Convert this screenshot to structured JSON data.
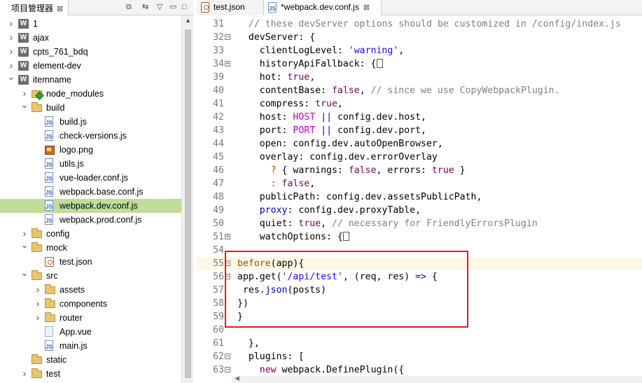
{
  "left_panel": {
    "tab_label": "项目管理器",
    "tab_close": "⊠",
    "toolbar": [
      "⧉",
      "⇆",
      "▽",
      "▭",
      "□"
    ],
    "tree": [
      {
        "label": "1",
        "icon": "project-icon",
        "depth": 0,
        "expanded": false
      },
      {
        "label": "ajax",
        "icon": "project-icon",
        "depth": 0,
        "expanded": false
      },
      {
        "label": "cpts_761_bdq",
        "icon": "project-icon",
        "depth": 0,
        "expanded": false
      },
      {
        "label": "element-dev",
        "icon": "project-icon",
        "depth": 0,
        "expanded": false
      },
      {
        "label": "itemname",
        "icon": "project-icon",
        "depth": 0,
        "expanded": true
      },
      {
        "label": "node_modules",
        "icon": "node-modules-folder-icon",
        "depth": 1,
        "expanded": false
      },
      {
        "label": "build",
        "icon": "folder-icon",
        "depth": 1,
        "expanded": true
      },
      {
        "label": "build.js",
        "icon": "js-file-icon",
        "depth": 2
      },
      {
        "label": "check-versions.js",
        "icon": "js-file-icon",
        "depth": 2
      },
      {
        "label": "logo.png",
        "icon": "image-file-icon",
        "depth": 2
      },
      {
        "label": "utils.js",
        "icon": "js-file-icon",
        "depth": 2
      },
      {
        "label": "vue-loader.conf.js",
        "icon": "js-file-icon",
        "depth": 2
      },
      {
        "label": "webpack.base.conf.js",
        "icon": "js-file-icon",
        "depth": 2
      },
      {
        "label": "webpack.dev.conf.js",
        "icon": "js-file-icon",
        "depth": 2,
        "selected": true
      },
      {
        "label": "webpack.prod.conf.js",
        "icon": "js-file-icon",
        "depth": 2
      },
      {
        "label": "config",
        "icon": "folder-icon",
        "depth": 1,
        "expanded": false
      },
      {
        "label": "mock",
        "icon": "folder-icon",
        "depth": 1,
        "expanded": true
      },
      {
        "label": "test.json",
        "icon": "json-file-icon",
        "depth": 2
      },
      {
        "label": "src",
        "icon": "folder-icon",
        "depth": 1,
        "expanded": true
      },
      {
        "label": "assets",
        "icon": "folder-icon",
        "depth": 2,
        "expanded": false
      },
      {
        "label": "components",
        "icon": "folder-icon",
        "depth": 2,
        "expanded": false
      },
      {
        "label": "router",
        "icon": "folder-icon",
        "depth": 2,
        "expanded": false
      },
      {
        "label": "App.vue",
        "icon": "vue-file-icon",
        "depth": 2
      },
      {
        "label": "main.js",
        "icon": "js-file-icon",
        "depth": 2
      },
      {
        "label": "static",
        "icon": "folder-icon",
        "depth": 1
      },
      {
        "label": "test",
        "icon": "folder-icon",
        "depth": 1,
        "expanded": false
      }
    ]
  },
  "editor": {
    "tabs": [
      {
        "label": "test.json",
        "icon": "json-file-icon",
        "close": "",
        "active": false
      },
      {
        "label": "*webpack.dev.conf.js",
        "icon": "js-file-icon",
        "close": "⊠",
        "active": true
      }
    ],
    "lines": [
      {
        "n": "31",
        "segs": [
          [
            "cm",
            "  // these devServer options should be customized in /config/index.js"
          ]
        ]
      },
      {
        "n": "32",
        "fold": "−",
        "segs": [
          [
            "",
            "  devServer: {"
          ]
        ]
      },
      {
        "n": "33",
        "segs": [
          [
            "",
            "    clientLogLevel: "
          ],
          [
            "st",
            "'warning'"
          ],
          [
            "",
            ","
          ]
        ]
      },
      {
        "n": "34",
        "fold": "+",
        "segs": [
          [
            "",
            "    historyApiFallback: {"
          ],
          [
            "box",
            ""
          ]
        ]
      },
      {
        "n": "39",
        "segs": [
          [
            "",
            "    hot: "
          ],
          [
            "k",
            "true"
          ],
          [
            "",
            ","
          ]
        ]
      },
      {
        "n": "40",
        "segs": [
          [
            "",
            "    contentBase: "
          ],
          [
            "k",
            "false"
          ],
          [
            "",
            ", "
          ],
          [
            "cm",
            "// since we use CopyWebpackPlugin."
          ]
        ]
      },
      {
        "n": "41",
        "segs": [
          [
            "",
            "    compress: "
          ],
          [
            "k",
            "true"
          ],
          [
            "",
            ","
          ]
        ]
      },
      {
        "n": "42",
        "segs": [
          [
            "",
            "    host: "
          ],
          [
            "rd",
            "HOST"
          ],
          [
            "",
            " "
          ],
          [
            "bl",
            "||"
          ],
          [
            "",
            " config.dev.host,"
          ]
        ]
      },
      {
        "n": "43",
        "segs": [
          [
            "",
            "    port: "
          ],
          [
            "rd",
            "PORT"
          ],
          [
            "",
            " "
          ],
          [
            "bl",
            "||"
          ],
          [
            "",
            " config.dev.port,"
          ]
        ]
      },
      {
        "n": "44",
        "segs": [
          [
            "",
            "    open: config.dev.autoOpenBrowser,"
          ]
        ]
      },
      {
        "n": "45",
        "segs": [
          [
            "",
            "    overlay: config.dev.errorOverlay"
          ]
        ]
      },
      {
        "n": "46",
        "segs": [
          [
            "",
            "      "
          ],
          [
            "fn",
            "?"
          ],
          [
            "",
            " { warnings: "
          ],
          [
            "k",
            "false"
          ],
          [
            "",
            ", errors: "
          ],
          [
            "k",
            "true"
          ],
          [
            "",
            " }"
          ]
        ]
      },
      {
        "n": "47",
        "segs": [
          [
            "",
            "      "
          ],
          [
            "fn",
            ":"
          ],
          [
            "",
            " "
          ],
          [
            "k",
            "false"
          ],
          [
            "",
            ","
          ]
        ]
      },
      {
        "n": "48",
        "segs": [
          [
            "",
            "    publicPath: config.dev.assetsPublicPath,"
          ]
        ]
      },
      {
        "n": "49",
        "segs": [
          [
            "",
            "    "
          ],
          [
            "bl",
            "proxy"
          ],
          [
            "",
            ": config.dev.proxyTable,"
          ]
        ]
      },
      {
        "n": "50",
        "segs": [
          [
            "",
            "    quiet: "
          ],
          [
            "k",
            "true"
          ],
          [
            "",
            ", "
          ],
          [
            "cm",
            "// necessary for FriendlyErrorsPlugin"
          ]
        ]
      },
      {
        "n": "51",
        "fold": "+",
        "segs": [
          [
            "",
            "    watchOptions: {"
          ],
          [
            "box",
            ""
          ]
        ]
      },
      {
        "n": "54",
        "segs": [
          [
            "",
            ""
          ]
        ]
      },
      {
        "n": "55",
        "fold": "−",
        "cur": true,
        "segs": [
          [
            "fn",
            "before"
          ],
          [
            "",
            "(app){"
          ]
        ]
      },
      {
        "n": "56",
        "fold": "−",
        "segs": [
          [
            "",
            "app.get("
          ],
          [
            "st",
            "'/api/test'"
          ],
          [
            "",
            ", (req, res) "
          ],
          [
            "bl",
            "=>"
          ],
          [
            "",
            " {"
          ]
        ]
      },
      {
        "n": "57",
        "segs": [
          [
            "",
            " res."
          ],
          [
            "bl",
            "json"
          ],
          [
            "",
            "(posts)"
          ]
        ]
      },
      {
        "n": "58",
        "segs": [
          [
            "",
            "})"
          ]
        ]
      },
      {
        "n": "59",
        "segs": [
          [
            "",
            "}"
          ]
        ]
      },
      {
        "n": "60",
        "segs": [
          [
            "",
            ""
          ]
        ]
      },
      {
        "n": "61",
        "segs": [
          [
            "",
            "  },"
          ]
        ]
      },
      {
        "n": "62",
        "fold": "−",
        "segs": [
          [
            "",
            "  plugins: ["
          ]
        ]
      },
      {
        "n": "63",
        "fold": "−",
        "segs": [
          [
            "",
            "    "
          ],
          [
            "k",
            "new"
          ],
          [
            "",
            " webpack.DefinePlugin({"
          ]
        ]
      }
    ]
  }
}
